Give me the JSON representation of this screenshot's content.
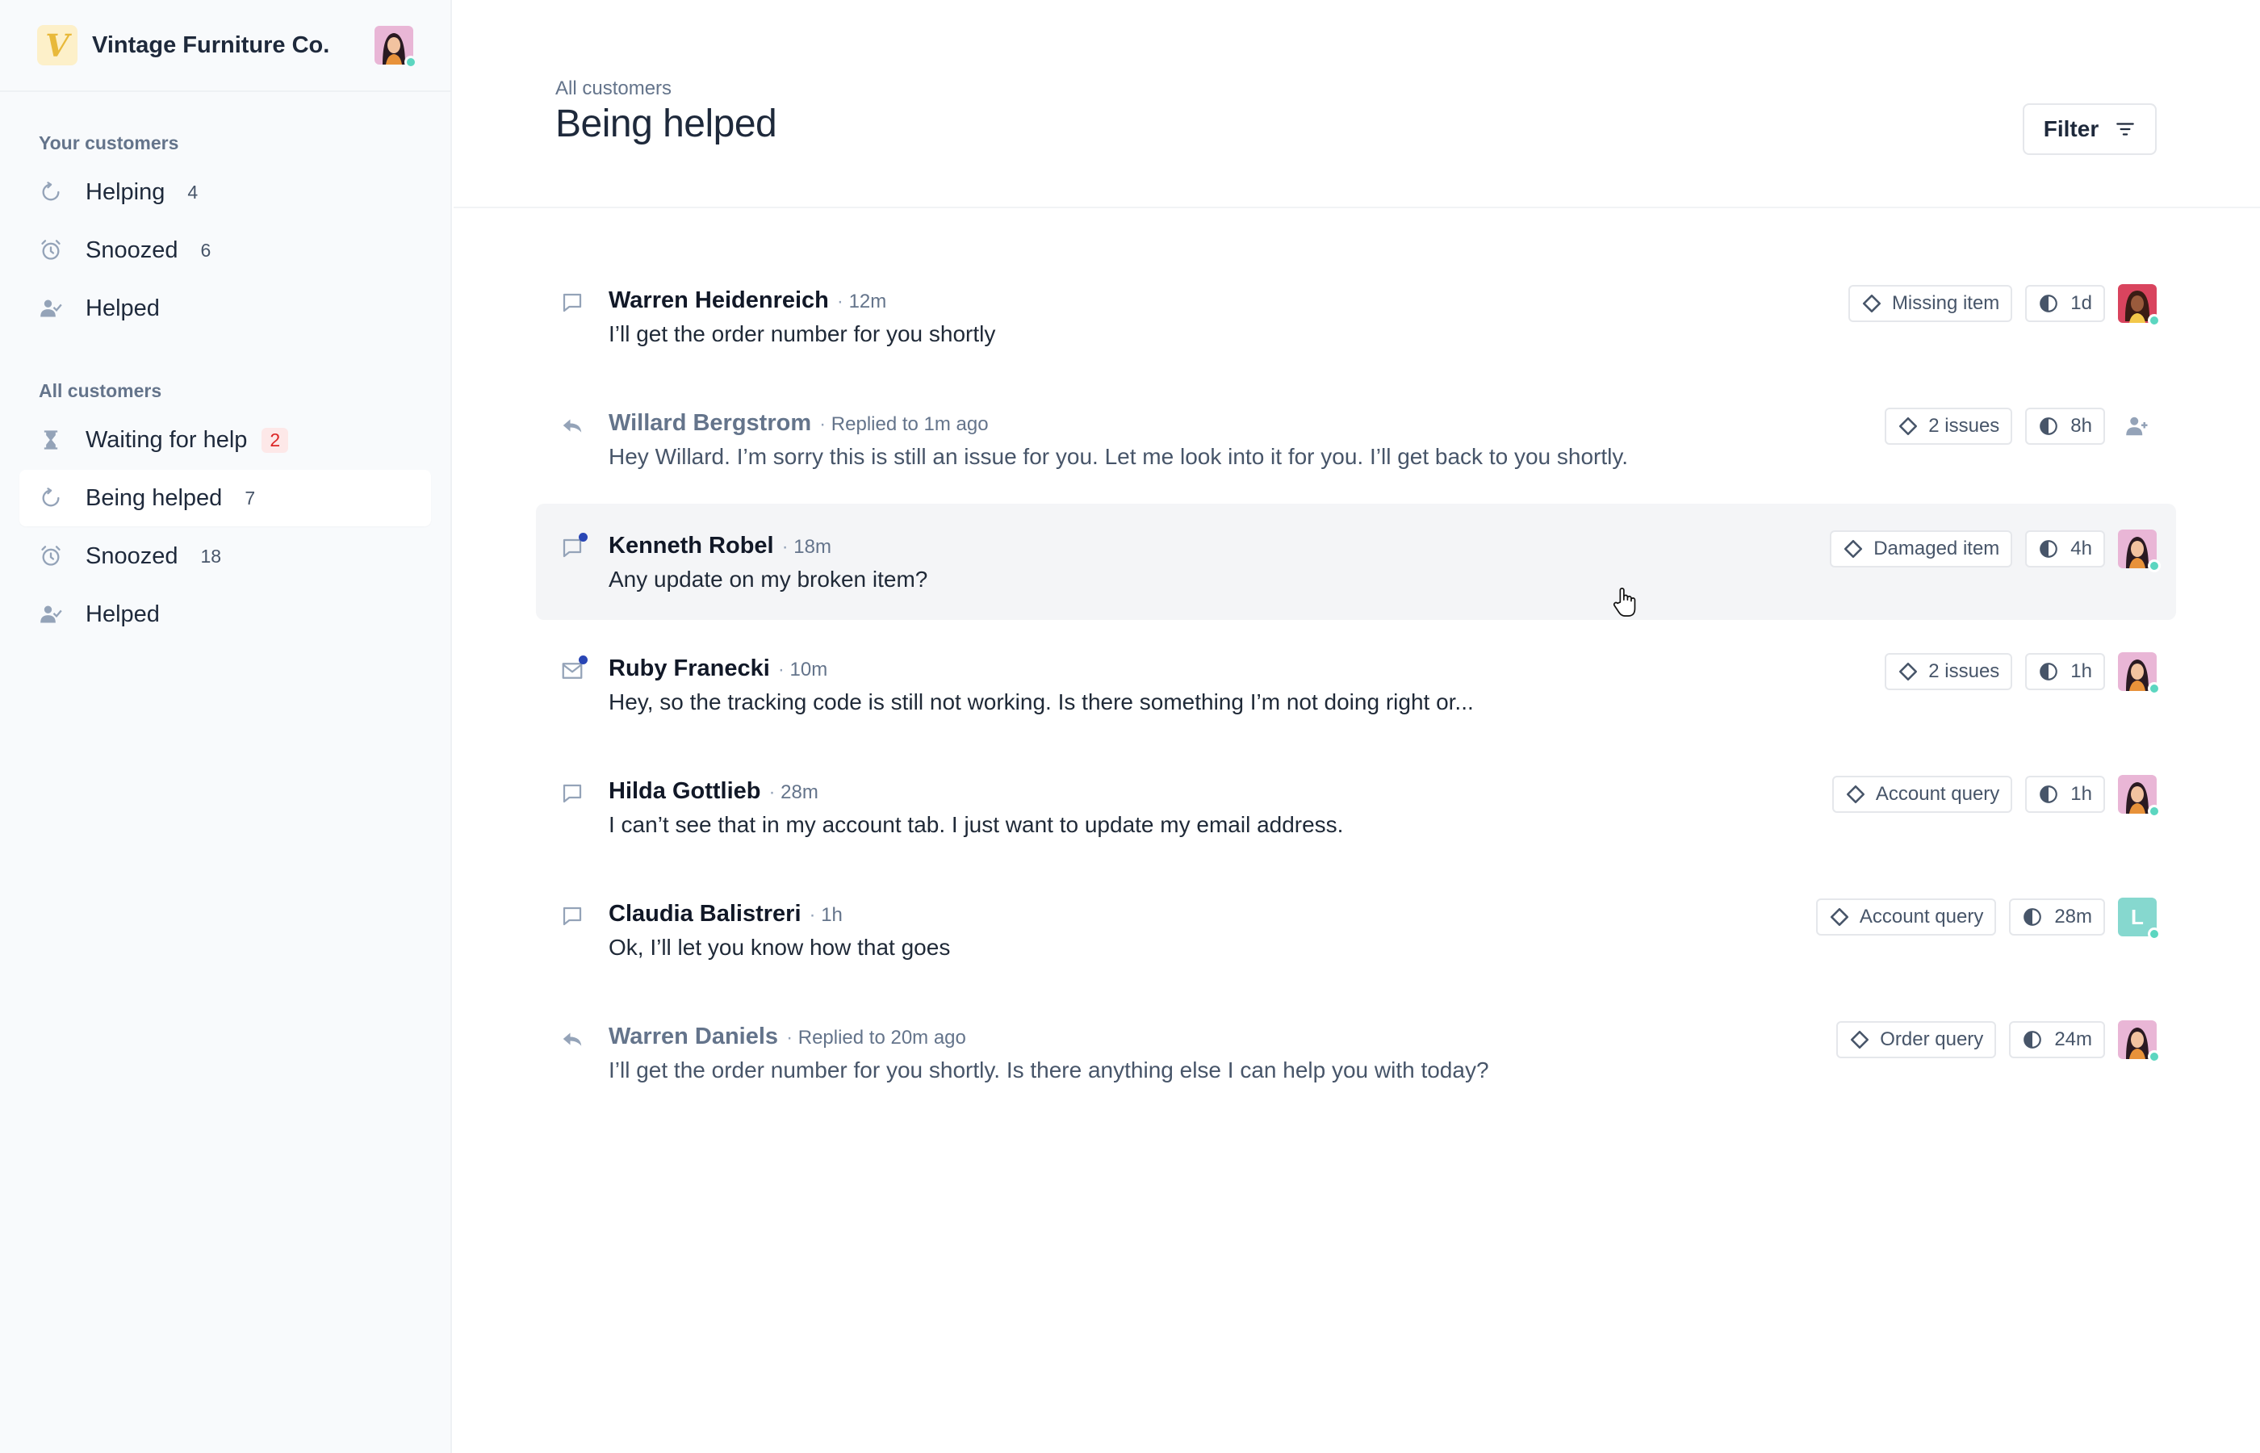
{
  "brand": {
    "name": "Vintage Furniture Co.",
    "logo_letter": "V"
  },
  "sidebar": {
    "your_title": "Your customers",
    "your_items": [
      {
        "label": "Helping",
        "count": "4",
        "icon": "refresh-icon"
      },
      {
        "label": "Snoozed",
        "count": "6",
        "icon": "alarm-icon"
      },
      {
        "label": "Helped",
        "count": "",
        "icon": "user-check-icon"
      }
    ],
    "all_title": "All customers",
    "all_items": [
      {
        "label": "Waiting for help",
        "count": "2",
        "icon": "hourglass-icon",
        "badge": "red"
      },
      {
        "label": "Being helped",
        "count": "7",
        "icon": "refresh-icon",
        "active": true
      },
      {
        "label": "Snoozed",
        "count": "18",
        "icon": "alarm-icon"
      },
      {
        "label": "Helped",
        "count": "",
        "icon": "user-check-icon"
      }
    ]
  },
  "header": {
    "breadcrumb": "All customers",
    "title": "Being helped",
    "filter_label": "Filter"
  },
  "conversations": [
    {
      "name": "Warren Heidenreich",
      "meta": "12m",
      "message": "I’ll get the order number for you shortly",
      "tag": "Missing item",
      "timer": "1d",
      "icon": "chat-icon",
      "assignee": "avatar-dark"
    },
    {
      "name": "Willard Bergstrom",
      "meta": "Replied to 1m ago",
      "message": "Hey Willard. I’m sorry this is still an issue for you. Let me look into it for you. I’ll get back to you shortly.",
      "tag": "2 issues",
      "timer": "8h",
      "icon": "reply-icon",
      "replied": true,
      "assignee": "assign-icon"
    },
    {
      "name": "Kenneth Robel",
      "meta": "18m",
      "message": "Any update on my broken item?",
      "tag": "Damaged item",
      "timer": "4h",
      "icon": "chat-icon",
      "unread": true,
      "assignee": "avatar"
    },
    {
      "name": "Ruby Franecki",
      "meta": "10m",
      "message": "Hey, so the tracking code is still not working. Is there something I’m not doing right or...",
      "tag": "2 issues",
      "timer": "1h",
      "icon": "mail-icon",
      "unread": true,
      "assignee": "avatar"
    },
    {
      "name": "Hilda Gottlieb",
      "meta": "28m",
      "message": "I can’t see that in my account tab. I just want to update my email address.",
      "tag": "Account query",
      "timer": "1h",
      "icon": "chat-icon",
      "assignee": "avatar"
    },
    {
      "name": "Claudia Balistreri",
      "meta": "1h",
      "message": "Ok, I’ll let you know how that goes",
      "tag": "Account query",
      "timer": "28m",
      "icon": "chat-icon",
      "assignee": "letter",
      "assignee_letter": "L"
    },
    {
      "name": "Warren Daniels",
      "meta": "Replied to 20m ago",
      "message": "I’ll get the order number for you shortly. Is there anything else I can help you with today?",
      "tag": "Order query",
      "timer": "24m",
      "icon": "reply-icon",
      "replied": true,
      "assignee": "avatar"
    }
  ],
  "colors": {
    "accent": "#2946b5",
    "online": "#5cd6c0",
    "badge_red": "#dc2626",
    "hover_row": "#f4f5f7",
    "letter_avatar": "#86d8cf"
  }
}
